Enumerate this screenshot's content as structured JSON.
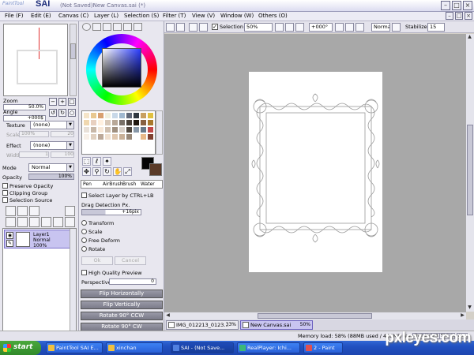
{
  "app": {
    "logo_small": "PaintTool",
    "logo_big": "SAI",
    "window_title": "(Not Saved)New Canvas.sai (*)"
  },
  "menu": [
    "File (F)",
    "Edit (E)",
    "Canvas (C)",
    "Layer (L)",
    "Selection (S)",
    "Filter (T)",
    "View (V)",
    "Window (W)",
    "Others (O)"
  ],
  "toolbar": {
    "selection_label": "Selection",
    "zoom_value": "50%",
    "rotation_value": "+000°",
    "blend_value": "Normal",
    "stabilizer_label": "Stabilizer",
    "stabilizer_value": "15"
  },
  "navigator": {
    "zoom_label": "Zoom",
    "zoom_value": "50.0%",
    "angle_label": "Angle",
    "angle_value": "+000$"
  },
  "paper_texture": {
    "texture_label": "Texture",
    "texture_value": "(none)",
    "scale_label": "Scale",
    "scale_value": "100%",
    "scale_num": "20",
    "effect_label": "Effect",
    "effect_value": "(none)",
    "width_label": "Width",
    "width_value": "1",
    "width_num": "100"
  },
  "layer_props": {
    "mode_label": "Mode",
    "mode_value": "Normal",
    "opacity_label": "Opacity",
    "opacity_value": "100%",
    "preserve_opacity": "Preserve Opacity",
    "clipping_group": "Clipping Group",
    "selection_source": "Selection Source"
  },
  "layers": [
    {
      "name": "Layer1",
      "mode": "Normal",
      "opacity": "100%"
    }
  ],
  "tool_options": {
    "select_layer_ctrl": "Select Layer by CTRL+LB",
    "drag_detection": "Drag Detection Px.",
    "drag_value": "+16pix",
    "transform_radios": [
      "Transform",
      "Scale",
      "Free Deform",
      "Rotate"
    ],
    "ok_label": "Ok",
    "cancel_label": "Cancel",
    "high_quality": "High Quality Preview",
    "perspective_label": "Perspective",
    "perspective_value": "0",
    "actions": [
      "Flip Horizontally",
      "Flip Vertically",
      "Rotate 90° CCW",
      "Rotate 90° CW"
    ]
  },
  "brush_tabs": [
    "Pen",
    "AirBrush",
    "Brush",
    "Water"
  ],
  "color": {
    "foreground": "#050505",
    "background": "#5a3a28",
    "swatches": [
      "#f4e4c8",
      "#e8c890",
      "#d8a070",
      "#f0f0e0",
      "#c8d8e8",
      "#a0b8d0",
      "#606878",
      "#303840",
      "#c8a060",
      "#e0c040",
      "#f0d8b0",
      "#e8d0c0",
      "#fff0e0",
      "#d8c8b8",
      "#b8a898",
      "#787068",
      "#484038",
      "#201810",
      "#886040",
      "#a8782c",
      "#e8e0d8",
      "#c8b8a8",
      "#f8e8d8",
      "#d0c0b0",
      "#a09080",
      "#d8d0c8",
      "#504840",
      "#8898a8",
      "#687888",
      "#c04848",
      "#f8f0e8",
      "#e0d0c0",
      "#bca898",
      "#f0e0d0",
      "#e0c8b0",
      "#c8b098",
      "#988878",
      "#ffffff",
      "#e8b888",
      "#804030"
    ]
  },
  "canvas_tabs": [
    {
      "name": "IMG_012213_0123...",
      "pct": "33%"
    },
    {
      "name": "New Canvas.sai",
      "pct": "50%"
    }
  ],
  "status": {
    "memory": "Memory load: 58% (88MB used / 425MB reserved)",
    "keys": [
      "Shift",
      "Ctrl",
      "Alt",
      "SPC",
      "⊞",
      "Any"
    ]
  },
  "taskbar": {
    "start": "start",
    "tasks": [
      "PaintTool SAI E...",
      "xinchan",
      "SAI - (Not Save...",
      "RealPlayer: Ichi...",
      "2 - Paint"
    ]
  },
  "watermark": "pxleyes.com"
}
